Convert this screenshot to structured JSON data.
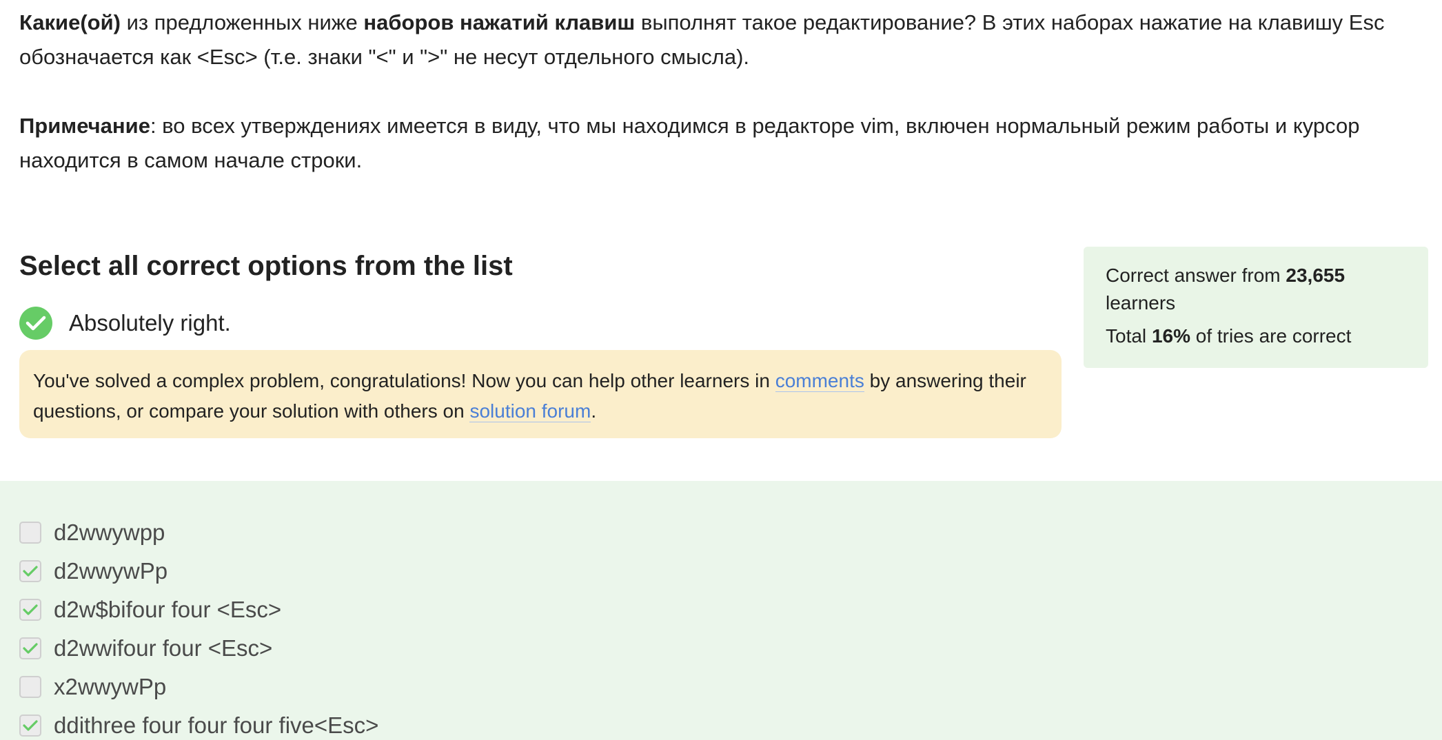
{
  "question": {
    "p1_bold1": "Какие(ой)",
    "p1_text1": " из предложенных ниже ",
    "p1_bold2": "наборов нажатий клавиш",
    "p1_text2": " выполнят такое редактирование? В этих наборах нажатие на клавишу Esc обозначается как <Esc> (т.е. знаки \"<\" и \">\" не несут отдельного смысла).",
    "p2_bold": "Примечание",
    "p2_text": ": во всех утверждениях имеется в виду, что мы находимся в редакторе vim, включен нормальный режим работы и курсор находится в самом начале строки."
  },
  "prompt_title": "Select all correct options from the list",
  "verdict": {
    "text": "Absolutely right.",
    "icon": "check-circle-icon",
    "color": "#66cc66"
  },
  "congrats": {
    "text1": "You've solved a complex problem, congratulations! Now you can help other learners in ",
    "link1": "comments",
    "text2": " by answering their questions, or compare your solution with others on ",
    "link2": "solution forum",
    "text3": "."
  },
  "stats": {
    "line1_prefix": "Correct answer from ",
    "learners_count": "23,655",
    "line1_suffix": " learners",
    "line2_prefix": "Total ",
    "percent": "16%",
    "line2_suffix": " of tries are correct"
  },
  "options": [
    {
      "label": "d2wwywpp",
      "checked": false
    },
    {
      "label": "d2wwywPp",
      "checked": true
    },
    {
      "label": "d2w$bifour four <Esc>",
      "checked": true
    },
    {
      "label": "d2wwifour four <Esc>",
      "checked": true
    },
    {
      "label": "x2wwywPp",
      "checked": false
    },
    {
      "label": "ddithree four four four five<Esc>",
      "checked": true
    }
  ],
  "colors": {
    "accent_green": "#66cc66",
    "link_blue": "#4a7fd6",
    "congrats_bg": "#fbeecb",
    "stats_bg": "#e9f5e7",
    "options_bg": "#ebf6eb"
  }
}
